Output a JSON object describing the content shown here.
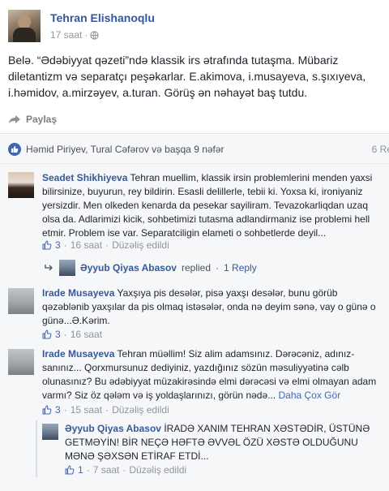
{
  "post": {
    "author": "Tehran Elishanoqlu",
    "time": "17 saat",
    "text": "Belə. “Ədəbiyyat qəzeti”ndə klassik irs ətrafında tutaşma. Mübariz diletantizm və separatçı peşəkarlar. E.akimova, i.musayeva, s.şıxıyeva, i.həmidov, a.mirzəyev, a.turan. Görüş ən nəhayət baş tutdu.",
    "share_label": "Paylaş",
    "likes_text": "Həmid Piriyev, Tural Cəfərov və başqa 9 nəfər",
    "likes_right": "6 Re"
  },
  "comments": [
    {
      "name": "Seadet Shikhiyeva",
      "text": "Tehran muellim, klassik irsin problemlerini menden yaxsi bilirsinize, buyurun, rey bildirin. Esasli delillerle, tebii ki. Yoxsa ki, ironiyaniz yersizdir. Men olkeden kenarda da pesekar sayiliram. Tevazokarliqdan uzaq olsa da. Adlarimizi kicik, sohbetimizi tutasma adlandirmaniz ise problemi hell etmir. Problem ise var. Separatciligin elameti o sohbetlerde deyil...",
      "likes": "3",
      "time": "16 saat",
      "edited": "Düzəliş edildi",
      "reply_preview": {
        "name": "Əyyub Qiyas Abasov",
        "action": "replied",
        "count": "1 Reply"
      }
    },
    {
      "name": "Irade Musayeva",
      "text": "Yaxşıya pis desələr, pisə yaxşı desələr, bunu görüb qəzəblənib yaxşılar da pis olmaq istəsələr, onda nə deyim sənə, vay o günə o günə...Ə.Kərim.",
      "likes": "3",
      "time": "16 saat"
    },
    {
      "name": "Irade Musayeva",
      "text": "Tehran müəllim! Siz alim adamsınız. Dərəcəniz, adınız-sanınız... Qorxmursunuz dediyiniz, yazdığınız sözün məsuliyyətinə cəlb olunasınız? Bu ədəbiyyat müzakirəsində elmi dərəcəsi və elmi olmayan adam varmı? Siz öz qələm və iş yoldaşlarınızı, görün nədə...",
      "more": "Daha Çox Gör",
      "likes": "3",
      "time": "15 saat",
      "edited": "Düzəliş edildi",
      "reply": {
        "name": "Əyyub Qiyas Abasov",
        "text": "İRADƏ XANIM TEHRAN XƏSTƏDİR, ÜSTÜNƏ GETMƏYİN! BİR NEÇƏ HƏFTƏ ƏVVƏL ÖZÜ XƏSTƏ OLDUĞUNU MƏNƏ ŞƏXSƏN ETİRAF ETDİ...",
        "likes": "1",
        "time": "7 saat",
        "edited": "Düzəliş edildi"
      }
    }
  ],
  "separators": {
    "dot": "·"
  },
  "colors": {
    "link": "#365899",
    "accent": "#4267b2",
    "muted": "#90949c",
    "bg_comments": "#f6f7f9"
  },
  "icons": [
    "globe-icon",
    "share-arrow-icon",
    "like-badge-icon",
    "thumbs-up-icon",
    "reply-arrow-icon"
  ]
}
